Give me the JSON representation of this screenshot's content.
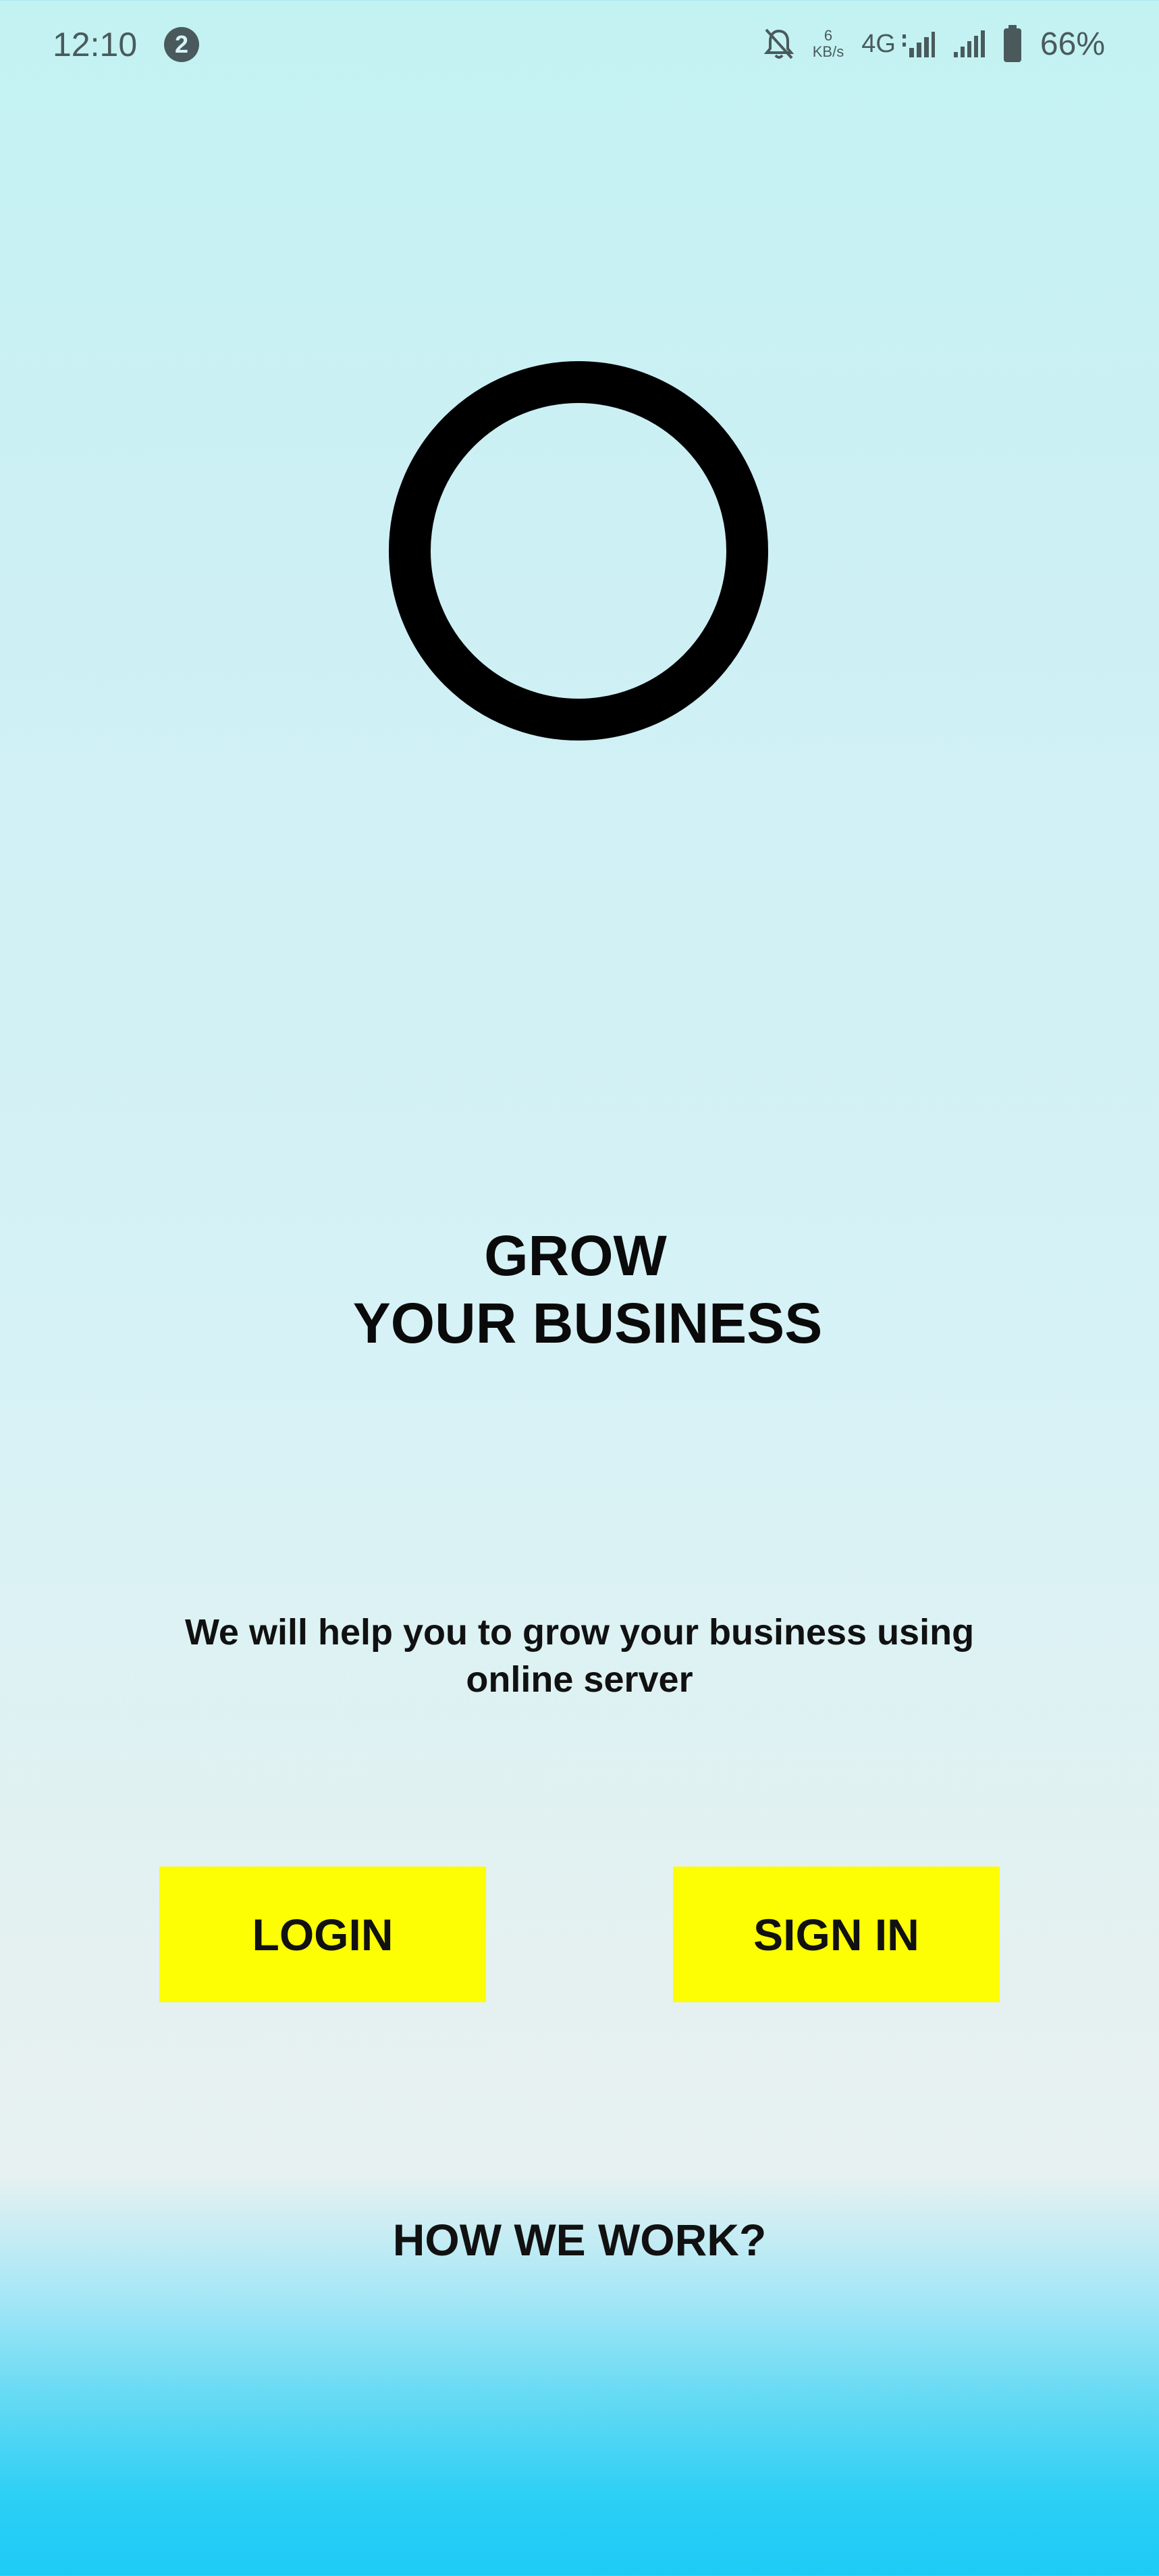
{
  "status_bar": {
    "time": "12:10",
    "notification_count": "2",
    "net_speed_value": "6",
    "net_speed_unit": "KB/s",
    "network_type": "4G",
    "battery": "66%",
    "icons": [
      "bell-muted-icon",
      "signal-4g-icon",
      "signal-icon",
      "battery-icon"
    ]
  },
  "logo": {
    "icon": "ring-logo-icon",
    "color": "#000000"
  },
  "headline": {
    "line1": "GROW",
    "line2": "YOUR BUSINESS"
  },
  "subtitle": {
    "line1": "We will help you to grow your business using",
    "line2": "online server"
  },
  "buttons": {
    "login": "LOGIN",
    "signin": "SIGN IN",
    "color": "#fdfd03"
  },
  "footer": {
    "how_we_work": "HOW WE WORK?"
  }
}
